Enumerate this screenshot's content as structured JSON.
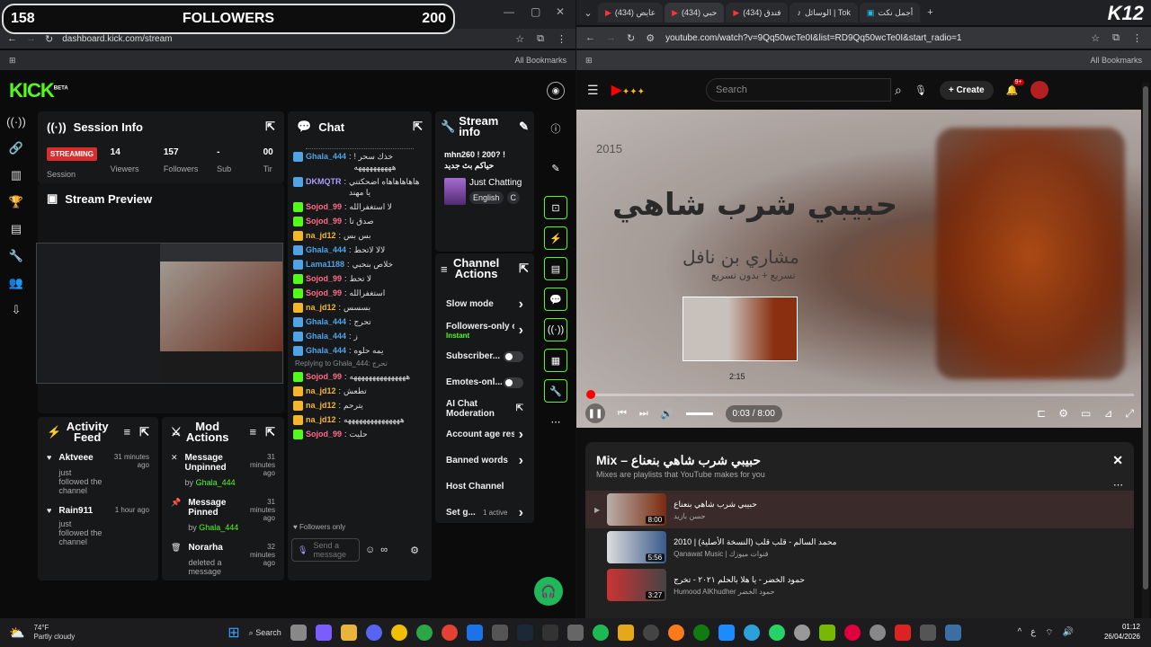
{
  "overlay": {
    "left_count": "158",
    "label": "FOLLOWERS",
    "right_count": "200"
  },
  "left_browser": {
    "url": "dashboard.kick.com/stream",
    "all_bookmarks": "All Bookmarks"
  },
  "kick": {
    "logo": "KICK",
    "logo_tag": "BETA",
    "session_info": {
      "title": "Session Info",
      "status": "STREAMING",
      "stats": [
        {
          "value": "14",
          "label": "Viewers"
        },
        {
          "value": "157",
          "label": "Followers"
        },
        {
          "value": "-",
          "label": "Sub"
        },
        {
          "value": "00",
          "label": "Tir"
        }
      ],
      "session_label": "Session"
    },
    "stream_preview": {
      "title": "Stream Preview"
    },
    "chat": {
      "title": "Chat",
      "messages": [
        {
          "user": "Ghala_444",
          "text": "خذك سحر ! ههههههههههه",
          "color": "u-blue"
        },
        {
          "user": "DKMQTR",
          "text": "هاهاهاهاهاه اضحكتني يا مهند",
          "color": "u-lav"
        },
        {
          "user": "Sojod_99",
          "text": "لا استغفرالله",
          "color": "u-pink"
        },
        {
          "user": "Sojod_99",
          "text": "صدق تا",
          "color": "u-pink"
        },
        {
          "user": "na_jd12",
          "text": "بس بس",
          "color": "u-gold"
        },
        {
          "user": "Ghala_444",
          "text": "لالا لاتحط",
          "color": "u-blue"
        },
        {
          "user": "Lama1188",
          "text": "خلاص بنحبي",
          "color": "u-blue"
        },
        {
          "user": "Sojod_99",
          "text": "لا تحط",
          "color": "u-pink"
        },
        {
          "user": "Sojod_99",
          "text": "استغفرالله",
          "color": "u-pink"
        },
        {
          "user": "na_jd12",
          "text": "بسسس",
          "color": "u-gold"
        },
        {
          "user": "Ghala_444",
          "text": "تحرج",
          "color": "u-blue"
        },
        {
          "user": "Ghala_444",
          "text": "ز",
          "color": "u-blue"
        },
        {
          "user": "Ghala_444",
          "text": "يمه حلوه",
          "color": "u-blue"
        }
      ],
      "reply_note": "Replying to Ghala_444: تحرج",
      "messages2": [
        {
          "user": "Sojod_99",
          "text": "هههههههههههههههه",
          "color": "u-pink"
        },
        {
          "user": "na_jd12",
          "text": "تطعش",
          "color": "u-gold"
        },
        {
          "user": "na_jd12",
          "text": "يترحم",
          "color": "u-gold"
        },
        {
          "user": "na_jd12",
          "text": "هههههههههههههههه",
          "color": "u-gold"
        },
        {
          "user": "Sojod_99",
          "text": "حليت",
          "color": "u-pink"
        }
      ],
      "followers_only": "Followers only",
      "send_placeholder": "Send a message"
    },
    "stream_info": {
      "title": "Stream info",
      "stream_title": "mhn260 ! 200? ! حياكم بث جديد",
      "category": "Just Chatting",
      "language": "English",
      "extra_tag": "C"
    },
    "channel_actions": {
      "title": "Channel Actions",
      "items": [
        {
          "label": "Slow mode",
          "sub": "",
          "ctl": "chevron"
        },
        {
          "label": "Followers-only c",
          "sub": "Instant",
          "ctl": "chevron"
        },
        {
          "label": "Subscriber...",
          "sub": "",
          "ctl": "toggle"
        },
        {
          "label": "Emotes-onl...",
          "sub": "",
          "ctl": "toggle"
        },
        {
          "label": "AI Chat Moderation",
          "sub": "",
          "ctl": "external"
        },
        {
          "label": "Account age res",
          "sub": "",
          "ctl": "chevron"
        },
        {
          "label": "Banned words",
          "sub": "",
          "ctl": "chevron"
        },
        {
          "label": "Host Channel",
          "sub": "",
          "ctl": "none"
        },
        {
          "label": "Set g...",
          "sub": "1 active",
          "ctl": "chevron"
        }
      ]
    },
    "activity_feed": {
      "title": "Activity Feed",
      "items": [
        {
          "name": "Aktveee",
          "action": "just followed the channel",
          "time": "31 minutes ago"
        },
        {
          "name": "Rain911",
          "action": "just followed the channel",
          "time": "1 hour ago"
        }
      ]
    },
    "mod_actions": {
      "title": "Mod Actions",
      "items": [
        {
          "title": "Message Unpinned",
          "by": "by",
          "mod": "Ghala_444",
          "time": "31 minutes ago"
        },
        {
          "title": "Message Pinned",
          "by": "by",
          "mod": "Ghala_444",
          "time": "31 minutes ago"
        },
        {
          "title": "Norarha",
          "by": "deleted a message",
          "mod": "",
          "time": "32 minutes ago"
        }
      ]
    }
  },
  "right_browser": {
    "tabs": [
      {
        "label": "(434) عايض"
      },
      {
        "label": "(434) حبي"
      },
      {
        "label": "(434) فندق"
      },
      {
        "label": "الوسائل | Tok"
      },
      {
        "label": "أجمل نكت"
      }
    ],
    "url": "youtube.com/watch?v=9Qq50wcTe0I&list=RD9Qq50wcTe0I&start_radio=1",
    "all_bookmarks": "All Bookmarks"
  },
  "youtube": {
    "search_placeholder": "Search",
    "create_label": "Create",
    "notif_count": "9+",
    "video": {
      "year": "2015",
      "title": "حبيبي شرب شاهي",
      "subtitle": "مشاري بن نافل",
      "subtitle2": "تسريع + بدون تسريع",
      "hover_time": "2:15",
      "time": "0:03 / 8:00",
      "progress": 0.006
    },
    "mix": {
      "title": "Mix – حبيبي شرب شاهي بنعناع",
      "desc": "Mixes are playlists that YouTube makes for you",
      "items": [
        {
          "title": "حبيبي شرب شاهي بنعناع",
          "channel": "حسن بازيد",
          "duration": "8:00"
        },
        {
          "title": "محمد السالم - قلب قلب (النسخة الأصلية) | 2010",
          "channel": "Qanawat Music | قنوات ميوزك",
          "duration": "5:56"
        },
        {
          "title": "حمود الخضر - يا هلا بالحلم ٢٠٢١ - تخرج",
          "channel": "Humood AlKhudher حمود الخضر",
          "duration": "3:27"
        }
      ]
    }
  },
  "taskbar": {
    "temp": "74°F",
    "weather": "Partly cloudy",
    "search": "Search",
    "time": "01:12",
    "date": "26/04/2026",
    "lang": "ع"
  },
  "watermark": {
    "k": "K",
    "num": "12"
  }
}
